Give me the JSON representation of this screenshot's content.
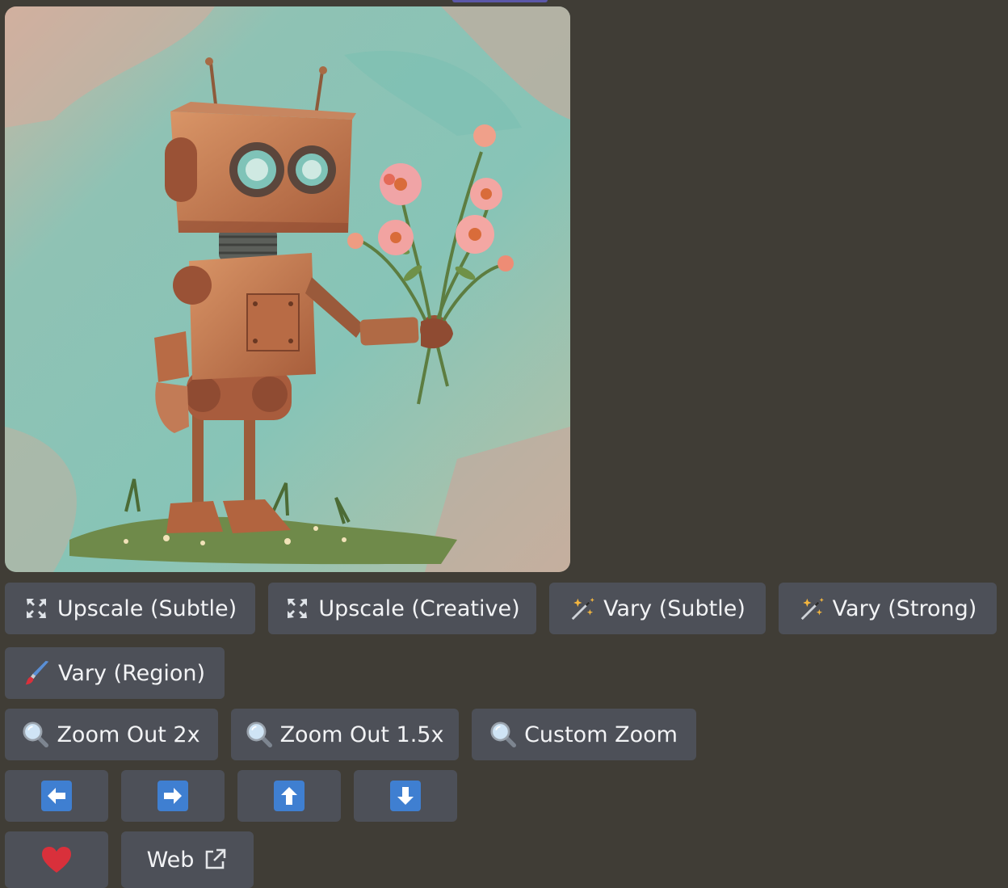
{
  "image": {
    "alt": "robot holding a bouquet of pink flowers"
  },
  "rows": {
    "upscale_subtle": {
      "label": "Upscale (Subtle)",
      "icon": "expand-arrows-icon"
    },
    "upscale_creative": {
      "label": "Upscale (Creative)",
      "icon": "expand-arrows-icon"
    },
    "vary_subtle": {
      "label": "Vary (Subtle)",
      "icon": "magic-wand-icon"
    },
    "vary_strong": {
      "label": "Vary (Strong)",
      "icon": "magic-wand-icon"
    },
    "vary_region": {
      "label": "Vary (Region)",
      "icon": "paintbrush-icon"
    },
    "zoom_out_2x": {
      "label": "Zoom Out 2x",
      "icon": "magnifier-icon"
    },
    "zoom_out_1_5x": {
      "label": "Zoom Out 1.5x",
      "icon": "magnifier-icon"
    },
    "custom_zoom": {
      "label": "Custom Zoom",
      "icon": "magnifier-icon"
    },
    "pan_left": {
      "icon": "arrow-left-icon"
    },
    "pan_right": {
      "icon": "arrow-right-icon"
    },
    "pan_up": {
      "icon": "arrow-up-icon"
    },
    "pan_down": {
      "icon": "arrow-down-icon"
    },
    "favorite": {
      "icon": "heart-icon"
    },
    "web": {
      "label": "Web",
      "icon": "external-link-icon"
    }
  },
  "colors": {
    "background": "#403d36",
    "button": "#4d5058",
    "button_text": "#f2f3f5",
    "arrow_tile": "#3f7fd1",
    "heart": "#d9303b"
  }
}
